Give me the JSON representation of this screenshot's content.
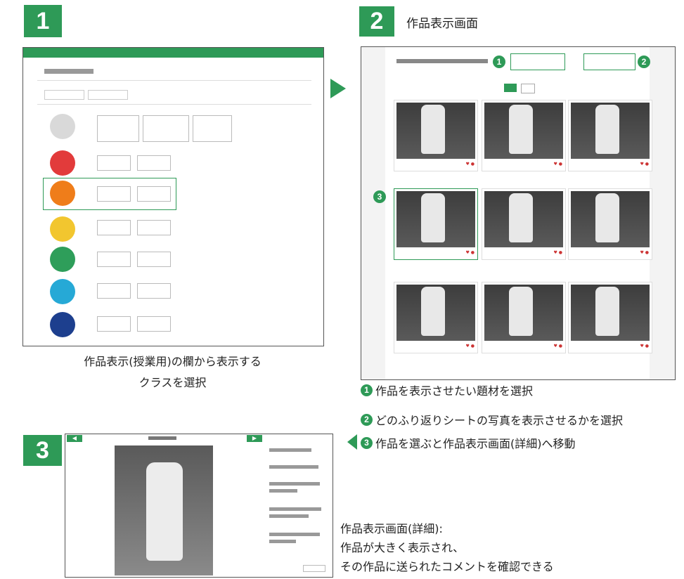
{
  "steps": {
    "one": "1",
    "two": "2",
    "three": "3"
  },
  "step2_title": "作品表示画面",
  "caption1": {
    "line1": "作品表示(授業用)の欄から表示する",
    "line2": "クラスを選択"
  },
  "notes": [
    {
      "num": "1",
      "text": "作品を表示させたい題材を選択"
    },
    {
      "num": "2",
      "text": "どのふり返りシートの写真を表示させるかを選択"
    },
    {
      "num": "3",
      "text": "作品を選ぶと作品表示画面(詳細)へ移動"
    }
  ],
  "caption3": {
    "line1": "作品表示画面(詳細):",
    "line2": "作品が大きく表示され、",
    "line3": "その作品に送られたコメントを確認できる"
  },
  "colors": {
    "accent": "#2e9a57",
    "class_circles": [
      "#d9d9d9",
      "#e23b3b",
      "#ef7d1a",
      "#f2c62f",
      "#2e9e5a",
      "#26a9d6",
      "#1d3f8e"
    ]
  }
}
